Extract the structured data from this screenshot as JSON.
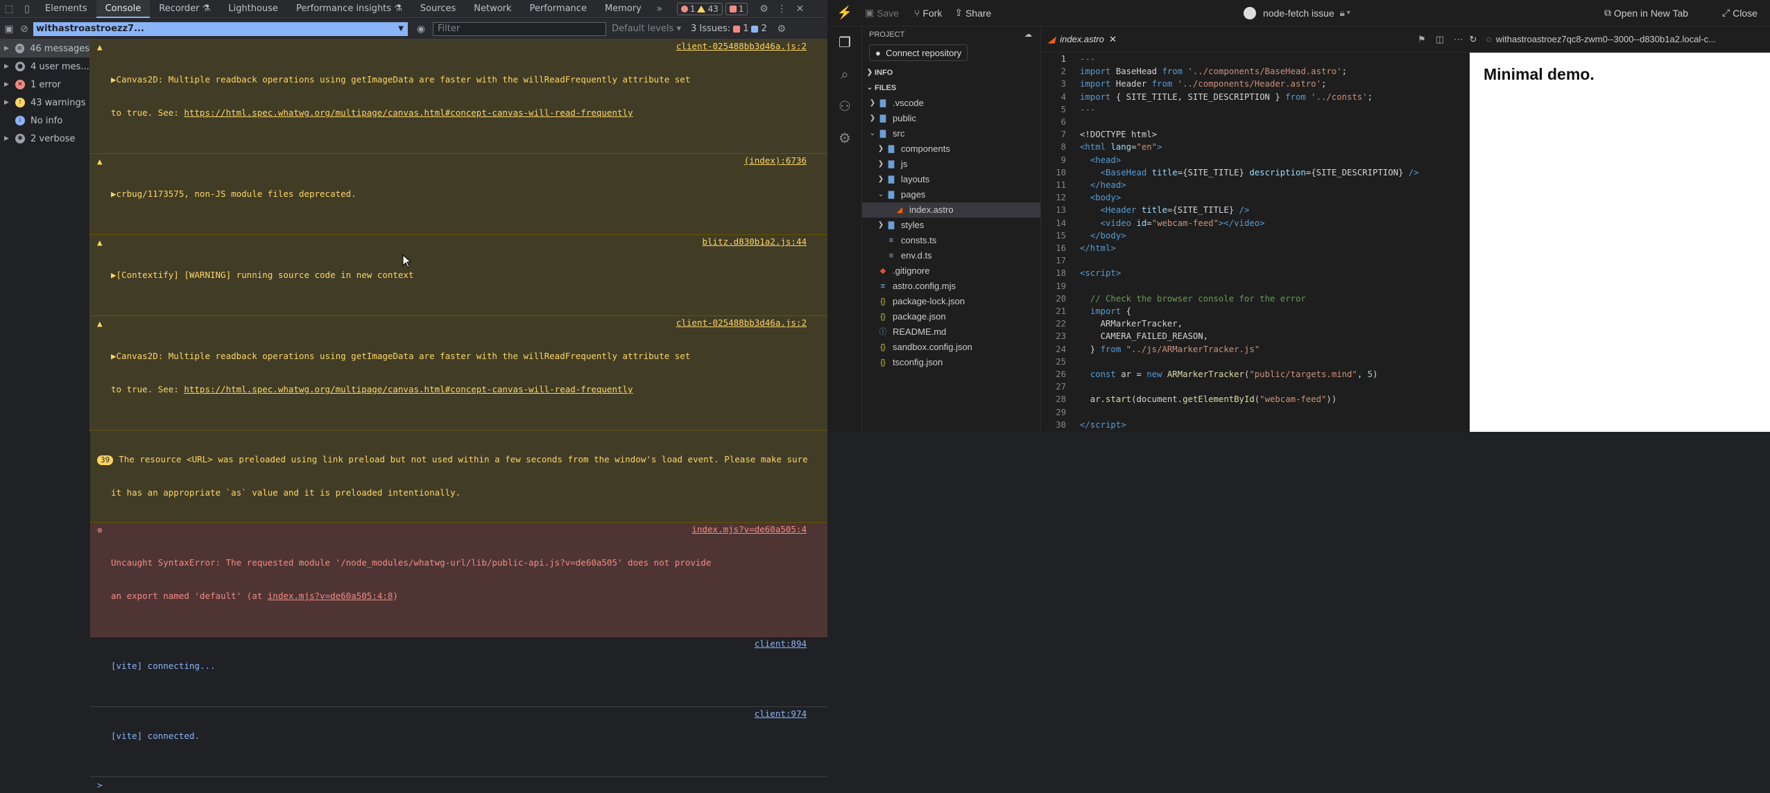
{
  "devtools": {
    "tabs": [
      "Elements",
      "Console",
      "Recorder",
      "Lighthouse",
      "Performance insights",
      "Sources",
      "Network",
      "Performance",
      "Memory"
    ],
    "active_tab": "Console",
    "badges": {
      "errors": "1",
      "warnings": "43",
      "issues": "1"
    },
    "toolbar": {
      "context": "withastroastroezz7...",
      "filter_placeholder": "Filter",
      "levels": "Default levels",
      "issues_label": "3 Issues:",
      "issues_err": "1",
      "issues_info": "2"
    },
    "sidebar": [
      {
        "label": "46 messages",
        "icon": "list-icon",
        "color": "#9aa0a6"
      },
      {
        "label": "4 user mes...",
        "icon": "user-icon",
        "color": "#9aa0a6"
      },
      {
        "label": "1 error",
        "icon": "error-icon",
        "color": "#f28b82"
      },
      {
        "label": "43 warnings",
        "icon": "warning-icon",
        "color": "#fdd663"
      },
      {
        "label": "No info",
        "icon": "info-icon",
        "color": "#8ab4f8"
      },
      {
        "label": "2 verbose",
        "icon": "bug-icon",
        "color": "#9aa0a6"
      }
    ],
    "console": {
      "w1_line1": "▶Canvas2D: Multiple readback operations using getImageData are faster with the willReadFrequently attribute set",
      "w1_line2_pre": "to true. See: ",
      "w1_link": "https://html.spec.whatwg.org/multipage/canvas.html#concept-canvas-will-read-frequently",
      "w1_src": "client-025488bb3d46a.js:2",
      "w2": "▶crbug/1173575, non-JS module files deprecated.",
      "w2_src": "(index):6736",
      "w3": "▶[Contextify] [WARNING] running source code in new context",
      "w3_src": "blitz.d830b1a2.js:44",
      "w4_line1": "▶Canvas2D: Multiple readback operations using getImageData are faster with the willReadFrequently attribute set",
      "w4_line2_pre": "to true. See: ",
      "w4_link": "https://html.spec.whatwg.org/multipage/canvas.html#concept-canvas-will-read-frequently",
      "w4_src": "client-025488bb3d46a.js:2",
      "w5_count": "39",
      "w5_line1": "The resource <URL> was preloaded using link preload but not used within a few seconds from the window's load event. Please make sure",
      "w5_line2": "it has an appropriate `as` value and it is preloaded intentionally.",
      "e1_line1": "Uncaught SyntaxError: The requested module '/node_modules/whatwg-url/lib/public-api.js?v=de60a505' does not provide",
      "e1_line2_pre": "an export named 'default' (at ",
      "e1_link": "index.mjs?v=de60a505:4:8",
      "e1_line2_post": ")",
      "e1_src": "index.mjs?v=de60a505:4",
      "v1": "[vite] connecting...",
      "v1_src": "client:894",
      "v2": "[vite] connected.",
      "v2_src": "client:974",
      "prompt": ">"
    }
  },
  "stackblitz": {
    "topbar": {
      "save": "Save",
      "fork": "Fork",
      "share": "Share",
      "project": "node-fetch issue",
      "open_tab": "Open in New Tab",
      "close": "Close"
    },
    "explorer": {
      "project_header": "PROJECT",
      "connect": "Connect repository",
      "info": "INFO",
      "files": "FILES",
      "items": [
        {
          "name": ".vscode",
          "type": "folder",
          "depth": 0,
          "open": false
        },
        {
          "name": "public",
          "type": "folder",
          "depth": 0,
          "open": false
        },
        {
          "name": "src",
          "type": "folder",
          "depth": 0,
          "open": true
        },
        {
          "name": "components",
          "type": "folder",
          "depth": 1,
          "open": false
        },
        {
          "name": "js",
          "type": "folder",
          "depth": 1,
          "open": false
        },
        {
          "name": "layouts",
          "type": "folder",
          "depth": 1,
          "open": false
        },
        {
          "name": "pages",
          "type": "folder",
          "depth": 1,
          "open": true
        },
        {
          "name": "index.astro",
          "type": "astro",
          "depth": 2,
          "selected": true
        },
        {
          "name": "styles",
          "type": "folder",
          "depth": 1,
          "open": false
        },
        {
          "name": "consts.ts",
          "type": "ts",
          "depth": 1
        },
        {
          "name": "env.d.ts",
          "type": "ts",
          "depth": 1
        },
        {
          "name": ".gitignore",
          "type": "git",
          "depth": 0
        },
        {
          "name": "astro.config.mjs",
          "type": "js",
          "depth": 0
        },
        {
          "name": "package-lock.json",
          "type": "json",
          "depth": 0
        },
        {
          "name": "package.json",
          "type": "json",
          "depth": 0
        },
        {
          "name": "README.md",
          "type": "md",
          "depth": 0
        },
        {
          "name": "sandbox.config.json",
          "type": "json",
          "depth": 0
        },
        {
          "name": "tsconfig.json",
          "type": "json",
          "depth": 0
        }
      ]
    },
    "editor": {
      "tab": "index.astro",
      "line_numbers": [
        "1",
        "2",
        "3",
        "4",
        "5",
        "6",
        "7",
        "8",
        "9",
        "10",
        "11",
        "12",
        "13",
        "14",
        "15",
        "16",
        "17",
        "18",
        "19",
        "20",
        "21",
        "22",
        "23",
        "24",
        "25",
        "26",
        "27",
        "28",
        "29",
        "30"
      ]
    },
    "preview": {
      "url": "withastroastroez7qc8-zwm0--3000--d830b1a2.local-c...",
      "heading": "Minimal demo."
    }
  }
}
